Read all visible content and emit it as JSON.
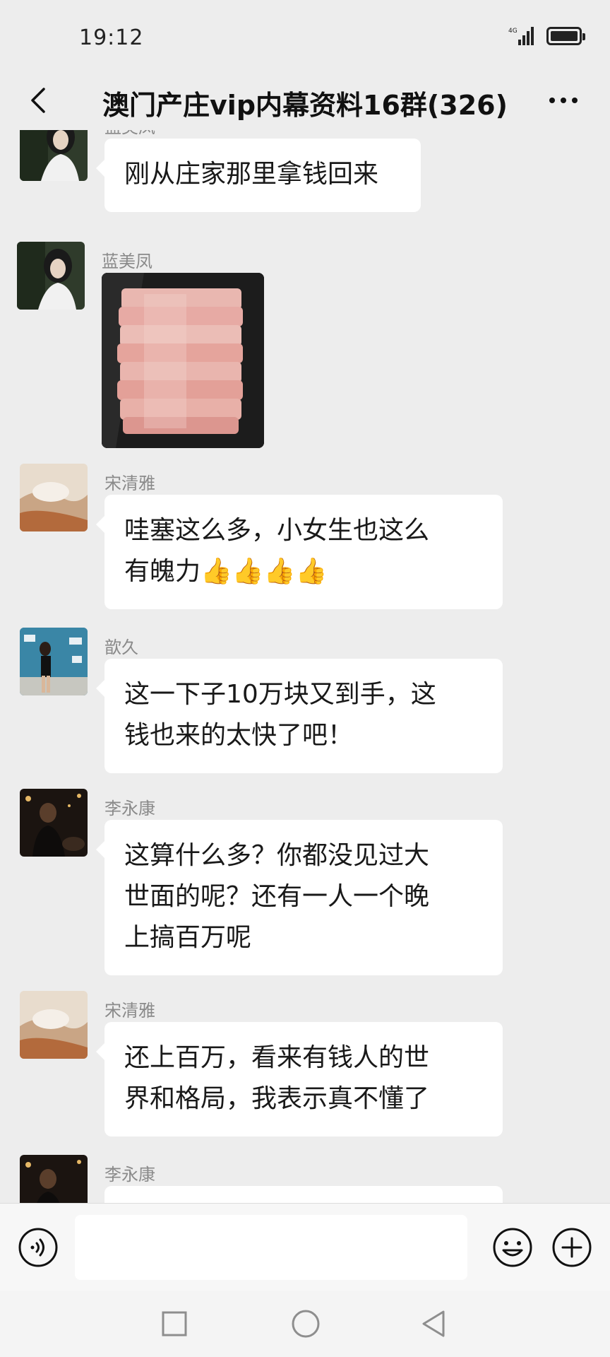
{
  "status": {
    "time": "19:12",
    "network": "4G"
  },
  "header": {
    "title": "澳门产庄vip内幕资料16群(326)"
  },
  "messages": [
    {
      "sender": "蓝美凤",
      "text": "刚从庄家那里拿钱回来"
    },
    {
      "sender": "蓝美凤",
      "image": "cash-stack-photo"
    },
    {
      "sender": "宋清雅",
      "line1": "哇塞这么多，小女生也这么",
      "line2": "有魄力",
      "emoji": "👍👍👍👍"
    },
    {
      "sender": "歆久",
      "line1": "这一下子10万块又到手，这",
      "line2": "钱也来的太快了吧！"
    },
    {
      "sender": "李永康",
      "line1": "这算什么多？你都没见过大",
      "line2": "世面的呢？还有一人一个晚",
      "line3": "上搞百万呢"
    },
    {
      "sender": "宋清雅",
      "line1": "还上百万，看来有钱人的世",
      "line2": "界和格局，我表示真不懂了"
    },
    {
      "sender": "李永康",
      "text": ""
    }
  ],
  "input": {
    "value": "",
    "placeholder": ""
  },
  "colors": {
    "background": "#ededed",
    "bubble": "#ffffff",
    "sender": "#8a8a8a"
  },
  "icons": [
    "back-arrow-icon",
    "more-icon",
    "voice-icon",
    "emoji-icon",
    "plus-icon",
    "nav-square-icon",
    "nav-home-icon",
    "nav-back-icon"
  ]
}
